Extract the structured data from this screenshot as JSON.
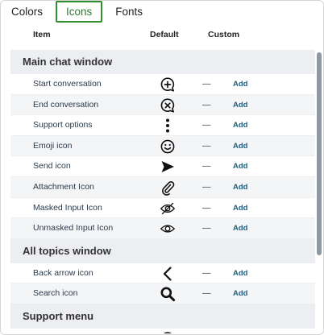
{
  "tabs": [
    {
      "label": "Colors",
      "active": false
    },
    {
      "label": "Icons",
      "active": true
    },
    {
      "label": "Fonts",
      "active": false
    }
  ],
  "columns": {
    "item": "Item",
    "default": "Default",
    "custom": "Custom"
  },
  "sections": [
    {
      "title": "Main chat window",
      "rows": [
        {
          "label": "Start conversation",
          "icon": "chat-plus-icon",
          "custom": "—",
          "action": "Add"
        },
        {
          "label": "End conversation",
          "icon": "chat-x-icon",
          "custom": "—",
          "action": "Add"
        },
        {
          "label": "Support options",
          "icon": "vertical-dots-icon",
          "custom": "—",
          "action": "Add"
        },
        {
          "label": "Emoji icon",
          "icon": "smiley-icon",
          "custom": "—",
          "action": "Add"
        },
        {
          "label": "Send icon",
          "icon": "send-arrow-icon",
          "custom": "—",
          "action": "Add"
        },
        {
          "label": "Attachment Icon",
          "icon": "paperclip-icon",
          "custom": "—",
          "action": "Add"
        },
        {
          "label": "Masked Input Icon",
          "icon": "eye-slash-icon",
          "custom": "—",
          "action": "Add"
        },
        {
          "label": "Unmasked Input Icon",
          "icon": "eye-icon",
          "custom": "—",
          "action": "Add"
        }
      ]
    },
    {
      "title": "All topics window",
      "rows": [
        {
          "label": "Back arrow icon",
          "icon": "chevron-left-icon",
          "custom": "—",
          "action": "Add"
        },
        {
          "label": "Search icon",
          "icon": "search-icon",
          "custom": "—",
          "action": "Add"
        }
      ]
    },
    {
      "title": "Support menu",
      "rows": [
        {
          "label": "",
          "icon": "chat-plus-icon",
          "custom": "",
          "action": ""
        }
      ]
    }
  ]
}
